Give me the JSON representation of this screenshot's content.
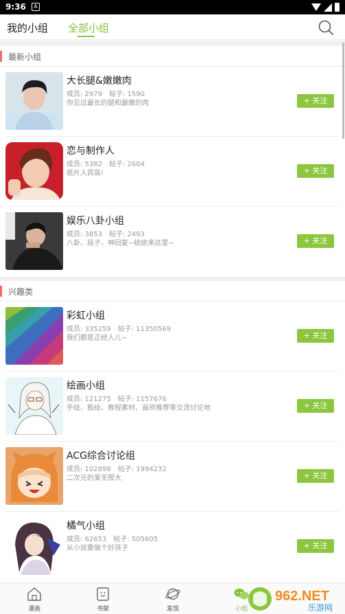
{
  "status_bar": {
    "time": "9:36",
    "notif_glyph": "A"
  },
  "header": {
    "tabs": [
      {
        "label": "我的小组",
        "active": false
      },
      {
        "label": "全部小组",
        "active": true
      }
    ],
    "search_icon": "search-icon"
  },
  "sections": [
    {
      "title": "最新小组",
      "groups": [
        {
          "name": "大长腿&嫩嫩肉",
          "members": "成员: 2979",
          "posts": "帖子: 1590",
          "desc": "你见过最长的腿和最嫩的肉",
          "follow": "+ 关注"
        },
        {
          "name": "恋与制作人",
          "members": "成员: 5382",
          "posts": "帖子: 2604",
          "desc": "纸片人宾高!",
          "follow": "+ 关注"
        },
        {
          "name": "娱乐八卦小组",
          "members": "成员: 3853",
          "posts": "帖子: 2493",
          "desc": "八卦、段子、神回复~统统来这里~",
          "follow": "+ 关注"
        }
      ]
    },
    {
      "title": "兴趣类",
      "groups": [
        {
          "name": "彩虹小组",
          "members": "成员: 335259",
          "posts": "帖子: 11350569",
          "desc": "我们都是正经人儿~",
          "follow": "+ 关注"
        },
        {
          "name": "绘画小组",
          "members": "成员: 121275",
          "posts": "帖子: 1157676",
          "desc": "手绘、板绘、教程素材、画师推荐等交流讨论地",
          "follow": "+ 关注"
        },
        {
          "name": "ACG综合讨论组",
          "members": "成员: 102898",
          "posts": "帖子: 1994232",
          "desc": "二次元的爱无限大",
          "follow": "+ 关注"
        },
        {
          "name": "橘气小组",
          "members": "成员: 62653",
          "posts": "帖子: 505605",
          "desc": "从小就要做个好孩子",
          "follow": "+ 关注"
        }
      ]
    }
  ],
  "bottom_nav": [
    {
      "label": "漫画",
      "icon": "house-icon"
    },
    {
      "label": "书架",
      "icon": "bookshelf-icon"
    },
    {
      "label": "发现",
      "icon": "planet-icon"
    },
    {
      "label": "小组",
      "icon": "chat-bubbles-icon",
      "active": true
    }
  ],
  "watermark": {
    "brand": "962.NET",
    "sub": "乐游网"
  },
  "colors": {
    "accent": "#88c140",
    "follow_bg": "#8cc63f",
    "section_marker": "#f26b6b"
  }
}
